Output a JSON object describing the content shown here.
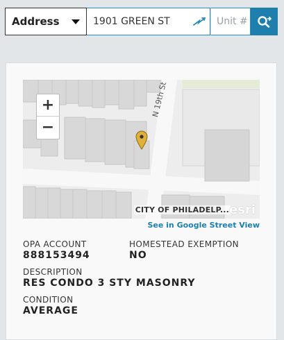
{
  "search": {
    "type_label": "Address",
    "address_value": "1901 GREEN ST",
    "unit_placeholder": "Unit #"
  },
  "map": {
    "street_label": "N 19th St",
    "attribution": "CITY OF PHILADELP...",
    "brand": "esri",
    "street_view_link": "See in Google Street View"
  },
  "property": {
    "opa_account_label": "OPA ACCOUNT",
    "opa_account_value": "888153494",
    "homestead_label": "HOMESTEAD EXEMPTION",
    "homestead_value": "NO",
    "description_label": "DESCRIPTION",
    "description_value": "RES CONDO 3 STY MASONRY",
    "condition_label": "CONDITION",
    "condition_value": "AVERAGE"
  },
  "colors": {
    "accent": "#1f7fac",
    "marker": "#e0b03a"
  },
  "icons": {
    "dropdown": "chevron-down-icon",
    "locate": "locate-icon",
    "search": "search-icon",
    "marker": "map-marker-icon"
  }
}
